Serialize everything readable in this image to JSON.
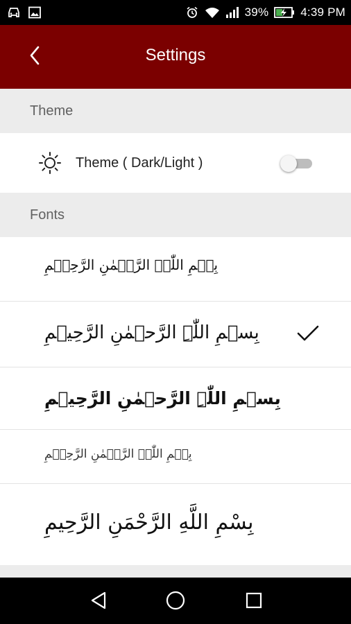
{
  "status_bar": {
    "left_icons": [
      "car-icon",
      "image-icon"
    ],
    "right_icons": [
      "alarm-icon",
      "wifi-icon",
      "signal-icon",
      "battery-charging-icon"
    ],
    "battery": "39%",
    "time": "4:39 PM"
  },
  "app_bar": {
    "title": "Settings",
    "back_icon": "chevron-left-icon",
    "color": "#7b0000"
  },
  "sections": {
    "theme": {
      "header": "Theme",
      "toggle_label": "Theme ( Dark/Light )",
      "toggle_icon": "sun-icon",
      "toggle_on": false
    },
    "fonts": {
      "header": "Fonts",
      "options": [
        {
          "sample": "بِسۡمِ اللّٰہِ الرَّحۡمٰنِ الرَّحِیۡمِ",
          "selected": false
        },
        {
          "sample": "بِسۡمِ اللّٰہِ الرَّحۡمٰنِ الرَّحِیۡمِ",
          "selected": true
        },
        {
          "sample": "بِسۡمِ اللّٰہِ الرَّحۡمٰنِ الرَّحِیۡمِ",
          "selected": false
        },
        {
          "sample": "بِسۡمِ اللّٰہِ الرَّحۡمٰنِ الرَّحِیۡمِ",
          "selected": false
        },
        {
          "sample": "بِسْمِ اللَّهِ الرَّحْمَنِ الرَّحِيمِ",
          "selected": false
        }
      ],
      "selected_icon": "checkmark-icon"
    }
  },
  "nav_bar": {
    "icons": [
      "back-triangle-icon",
      "home-circle-icon",
      "recents-square-icon"
    ]
  }
}
